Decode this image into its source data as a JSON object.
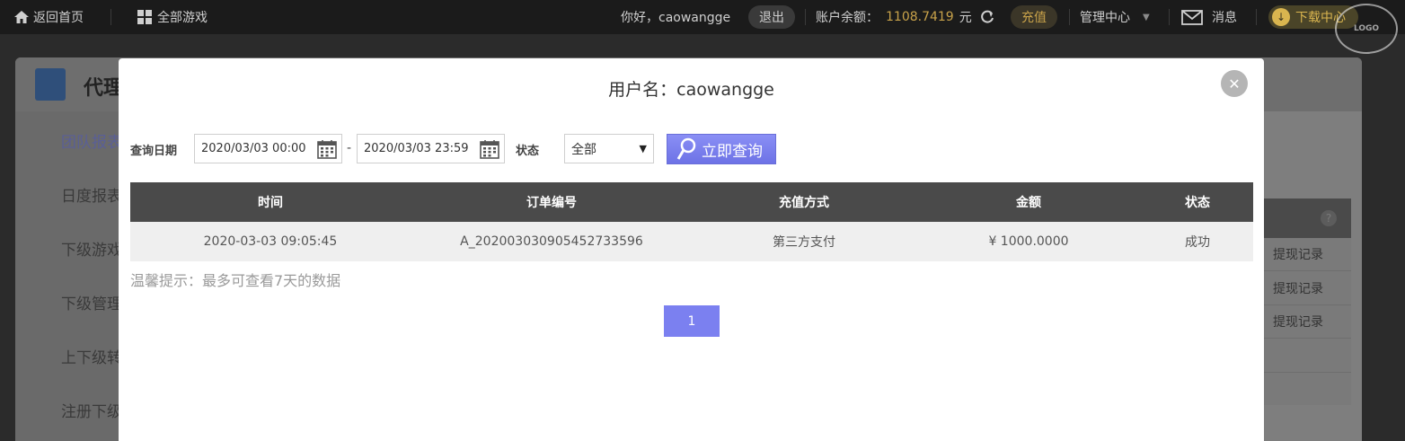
{
  "topbar": {
    "home": "返回首页",
    "all_games": "全部游戏",
    "greeting": "你好，caowangge",
    "logout": "退出",
    "balance_label": "账户余额：",
    "balance_value": "1108.7419",
    "balance_unit": "元",
    "recharge": "充值",
    "management": "管理中心",
    "messages": "消息",
    "download": "下载中心"
  },
  "background": {
    "page_title": "代理",
    "sidebar": [
      "团队报表",
      "日度报表",
      "下级游戏",
      "下级管理",
      "上下级转",
      "注册下级"
    ],
    "right_rows": [
      "提现记录",
      "提现记录",
      "提现记录"
    ]
  },
  "modal": {
    "title": "用户名：caowangge",
    "query_label": "查询日期",
    "start_date": "2020/03/03 00:00",
    "dash": "-",
    "end_date": "2020/03/03 23:59",
    "status_label": "状态",
    "status_selected": "全部",
    "search_button": "立即查询",
    "table": {
      "headers": [
        "时间",
        "订单编号",
        "充值方式",
        "金额",
        "状态"
      ],
      "rows": [
        [
          "2020-03-03 09:05:45",
          "A_202003030905452733596",
          "第三方支付",
          "¥ 1000.0000",
          "成功"
        ]
      ]
    },
    "tip": "温馨提示：最多可查看7天的数据",
    "current_page": "1"
  }
}
